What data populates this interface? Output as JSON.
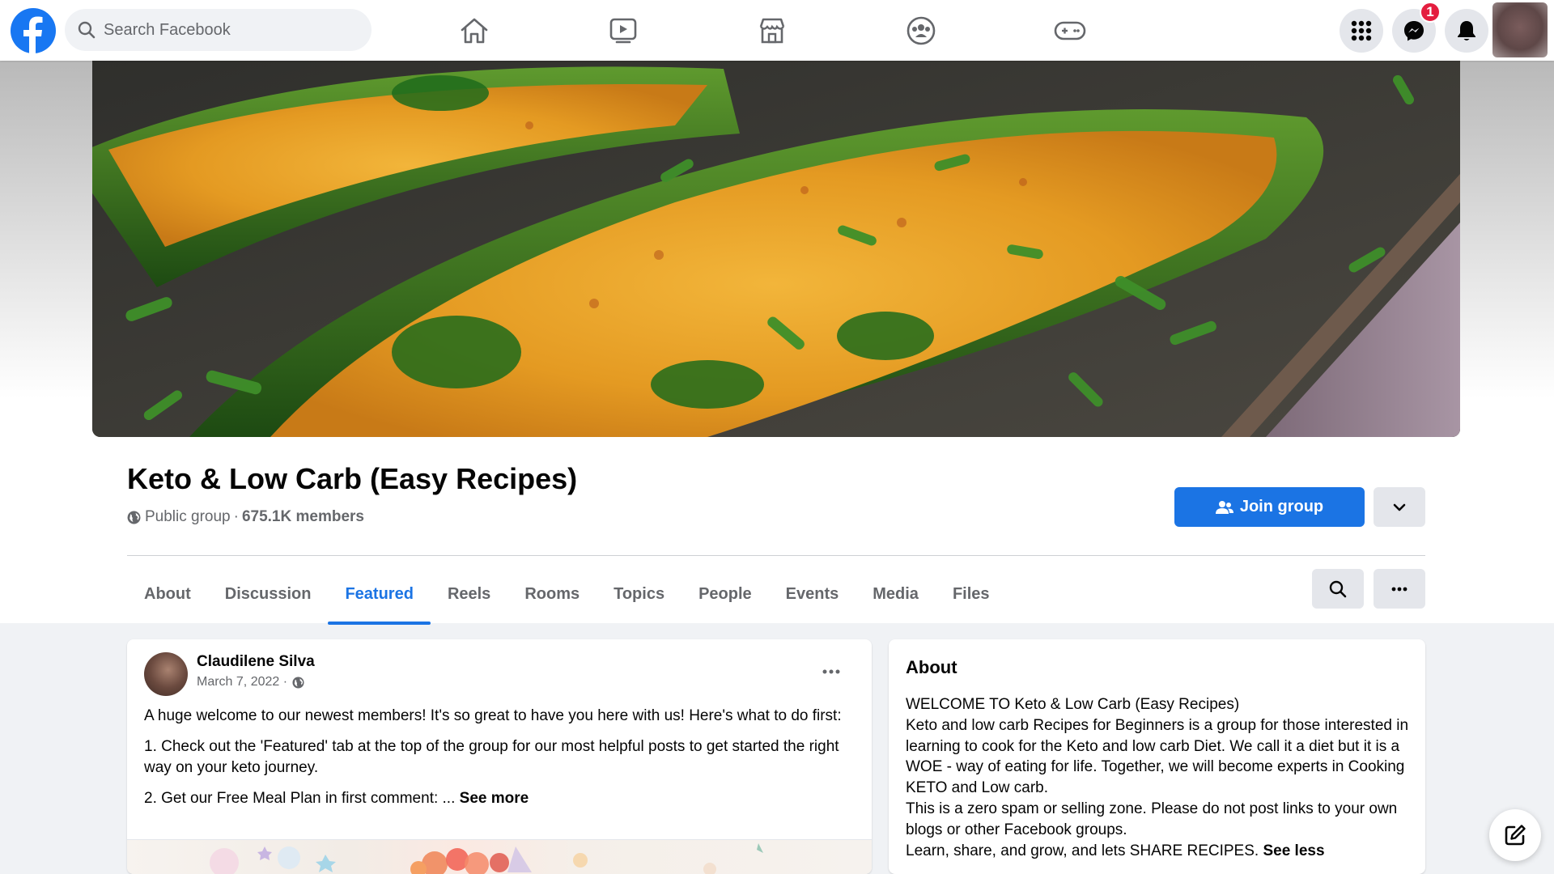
{
  "topbar": {
    "search_placeholder": "Search Facebook",
    "nav": [
      "home-icon",
      "watch-icon",
      "marketplace-icon",
      "groups-icon",
      "gaming-icon"
    ],
    "messenger_badge": "1",
    "brand_color": "#1877f2"
  },
  "group": {
    "title": "Keto & Low Carb (Easy Recipes)",
    "privacy": "Public group",
    "separator": "·",
    "members": "675.1K members",
    "join_label": "Join group"
  },
  "tabs": [
    {
      "label": "About",
      "active": false
    },
    {
      "label": "Discussion",
      "active": false
    },
    {
      "label": "Featured",
      "active": true
    },
    {
      "label": "Reels",
      "active": false
    },
    {
      "label": "Rooms",
      "active": false
    },
    {
      "label": "Topics",
      "active": false
    },
    {
      "label": "People",
      "active": false
    },
    {
      "label": "Events",
      "active": false
    },
    {
      "label": "Media",
      "active": false
    },
    {
      "label": "Files",
      "active": false
    }
  ],
  "post": {
    "author": "Claudilene Silva",
    "date": "March 7, 2022 ·",
    "p1": "A huge welcome to our newest members! It's so great to have you here with us! Here's what to do first:",
    "p2": "1. Check out the 'Featured' tab at the top of the group for our most helpful posts to get started the right way on your keto journey.",
    "p3": "2. Get our Free Meal Plan in first comment: ... ",
    "see_more": "See more"
  },
  "about": {
    "title": "About",
    "l1": "WELCOME TO Keto & Low Carb (Easy Recipes)",
    "l2": "Keto and low carb Recipes for Beginners is a group for those interested in learning to cook for the Keto and low carb Diet. We call it a diet but it is a WOE - way of eating for life. Together, we will become experts in Cooking KETO and Low carb.",
    "l3": "This is a zero spam or selling zone. Please do not post links to your own blogs or other Facebook groups.",
    "l4": "Learn, share, and grow, and lets SHARE RECIPES. ",
    "see_less": "See less"
  }
}
